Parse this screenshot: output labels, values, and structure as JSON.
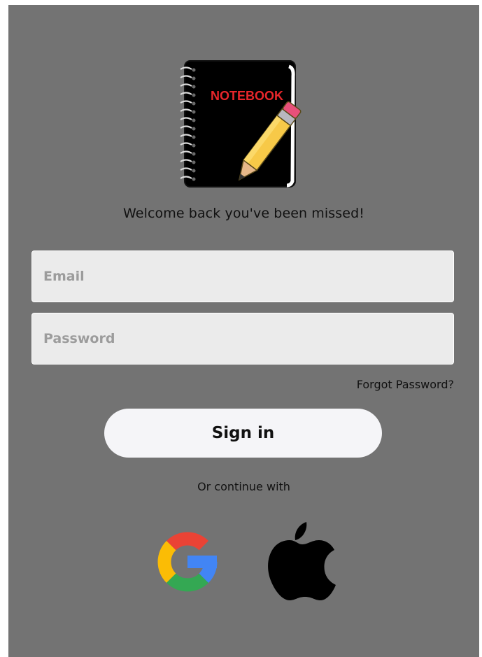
{
  "logo": {
    "text": "NOTEBOOK",
    "icon": "notebook-pencil-icon",
    "text_color": "#e8262b"
  },
  "welcome_text": "Welcome back you've been missed!",
  "form": {
    "email_placeholder": "Email",
    "password_placeholder": "Password",
    "forgot_label": "Forgot Password?",
    "signin_label": "Sign in"
  },
  "alt_login": {
    "label": "Or continue with",
    "providers": [
      {
        "name": "Google",
        "icon": "google-icon"
      },
      {
        "name": "Apple",
        "icon": "apple-icon"
      }
    ]
  },
  "colors": {
    "background": "#737373",
    "field": "#ebebeb",
    "button": "#f5f5f8"
  }
}
